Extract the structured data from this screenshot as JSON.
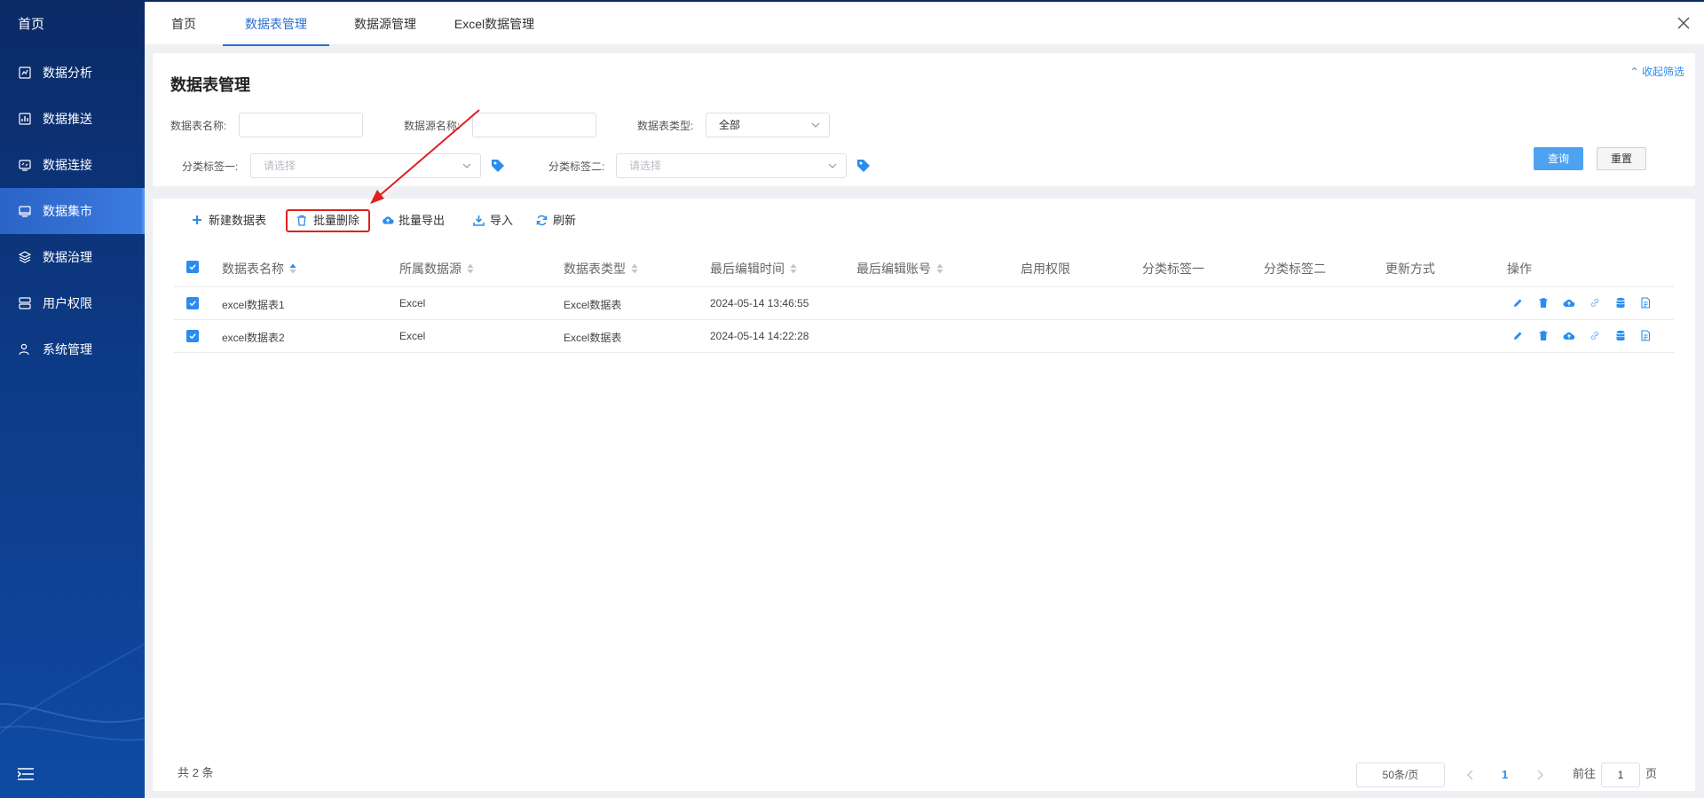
{
  "sidebar": {
    "home": "首页",
    "items": [
      {
        "label": "数据分析",
        "icon": "chart-icon"
      },
      {
        "label": "数据推送",
        "icon": "bar-chart-icon"
      },
      {
        "label": "数据连接",
        "icon": "connect-icon"
      },
      {
        "label": "数据集市",
        "icon": "monitor-icon",
        "active": true
      },
      {
        "label": "数据治理",
        "icon": "layers-icon"
      },
      {
        "label": "用户权限",
        "icon": "permission-icon"
      },
      {
        "label": "系统管理",
        "icon": "user-gear-icon"
      }
    ]
  },
  "tabs": [
    "首页",
    "数据表管理",
    "数据源管理",
    "Excel数据管理"
  ],
  "active_tab": "数据表管理",
  "filter": {
    "title": "数据表管理",
    "collapse_label": "收起筛选",
    "table_name_label": "数据表名称:",
    "source_name_label": "数据源名称:",
    "table_type_label": "数据表类型:",
    "table_type_value": "全部",
    "tag1_label": "分类标签一:",
    "tag1_placeholder": "请选择",
    "tag2_label": "分类标签二:",
    "tag2_placeholder": "请选择",
    "query_label": "查询",
    "reset_label": "重置"
  },
  "toolbar": {
    "new_label": "新建数据表",
    "batch_delete_label": "批量删除",
    "batch_export_label": "批量导出",
    "import_label": "导入",
    "refresh_label": "刷新"
  },
  "table": {
    "headers": [
      "数据表名称",
      "所属数据源",
      "数据表类型",
      "最后编辑时间",
      "最后编辑账号",
      "启用权限",
      "分类标签一",
      "分类标签二",
      "更新方式",
      "操作"
    ],
    "rows": [
      {
        "name": "excel数据表1",
        "source": "Excel",
        "type": "Excel数据表",
        "time": "2024-05-14 13:46:55"
      },
      {
        "name": "excel数据表2",
        "source": "Excel",
        "type": "Excel数据表",
        "time": "2024-05-14 14:22:28"
      }
    ]
  },
  "pagination": {
    "total": "共 2 条",
    "page_size": "50条/页",
    "current_page": "1",
    "goto_prefix": "前往",
    "goto_value": "1",
    "goto_suffix": "页"
  },
  "colors": {
    "accent": "#2b8cf0",
    "highlight_box": "#e02020",
    "sidebar_bg": "#0d3a86"
  }
}
